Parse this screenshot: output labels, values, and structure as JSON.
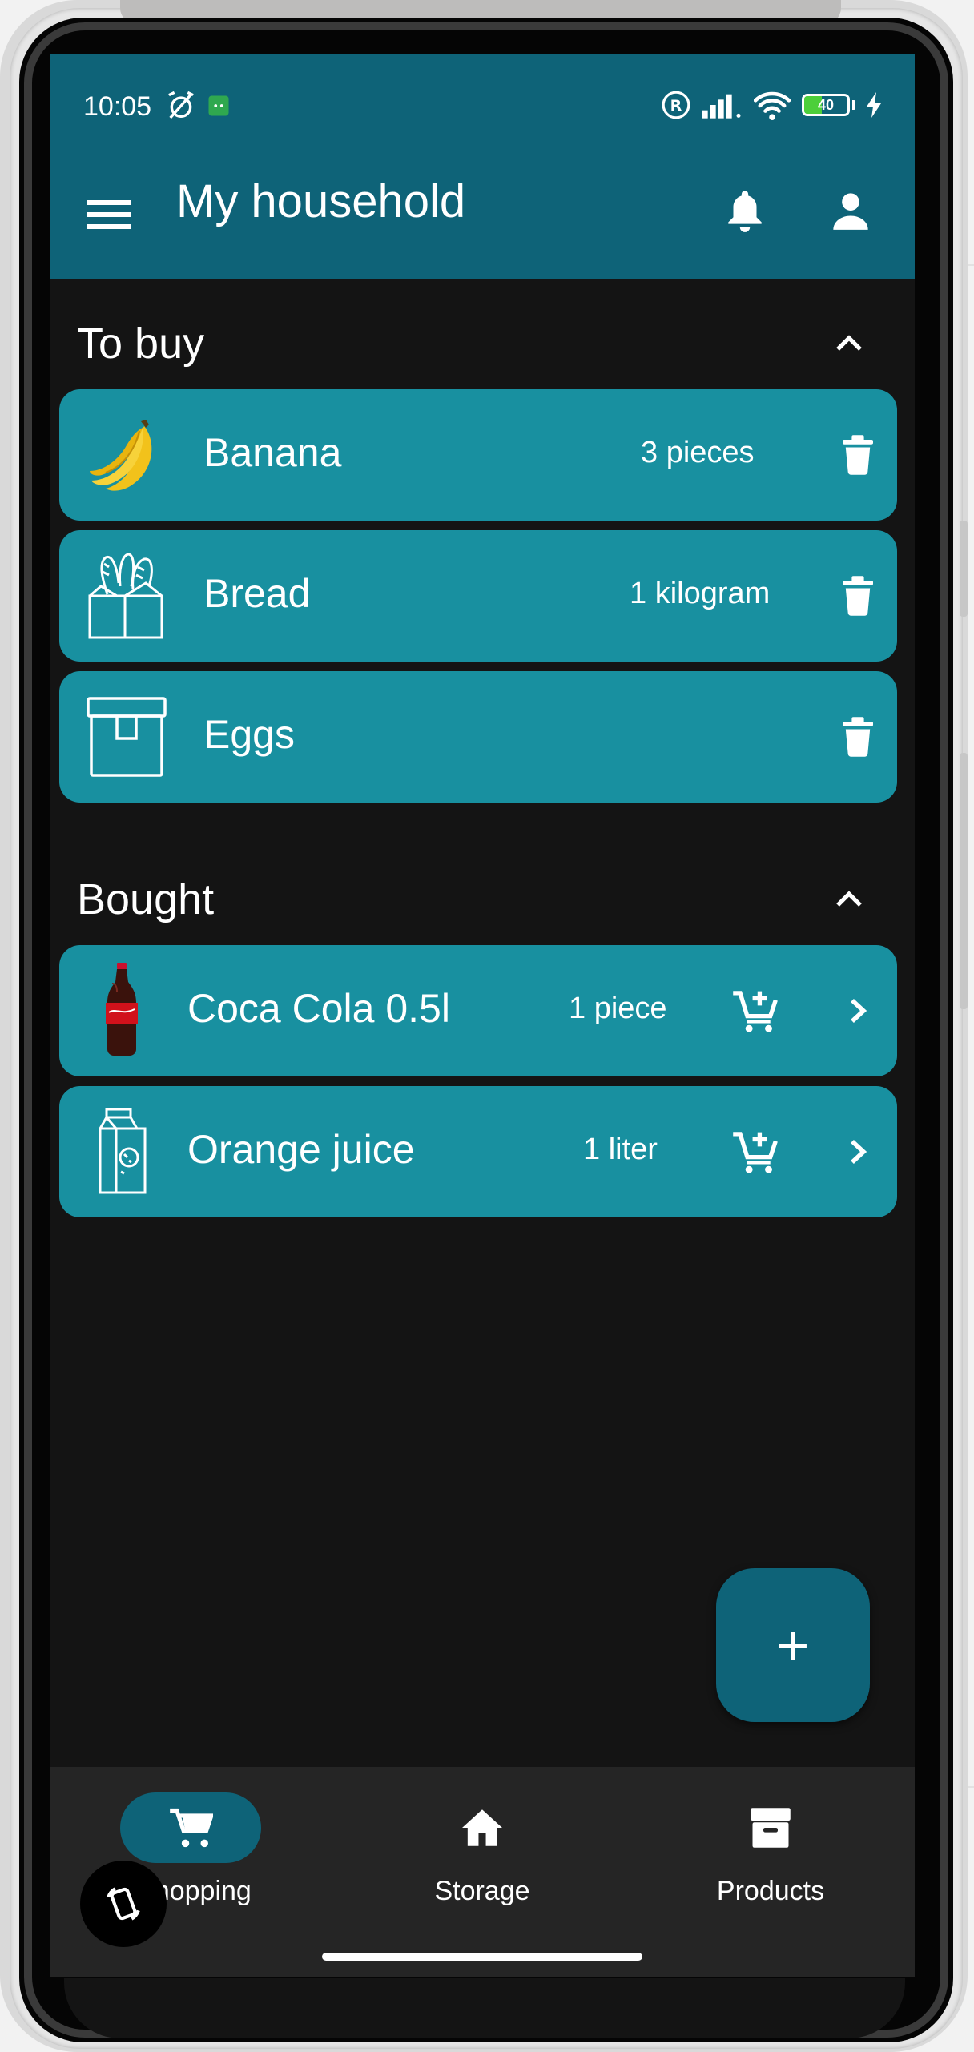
{
  "status_bar": {
    "time": "10:05",
    "battery": "40"
  },
  "app_bar": {
    "title": "My household"
  },
  "to_buy": {
    "title": "To buy",
    "items": [
      {
        "name": "Banana",
        "quantity": "3 pieces",
        "image": "banana-icon"
      },
      {
        "name": "Bread",
        "quantity": "1 kilogram",
        "image": "bread-bag-icon"
      },
      {
        "name": "Eggs",
        "quantity": "",
        "image": "storage-box-icon"
      }
    ]
  },
  "bought": {
    "title": "Bought",
    "items": [
      {
        "name": "Coca Cola 0.5l",
        "quantity": "1 piece",
        "image": "cola-bottle-icon"
      },
      {
        "name": "Orange juice",
        "quantity": "1 liter",
        "image": "juice-carton-icon"
      }
    ]
  },
  "fab": {
    "label": "+"
  },
  "bottom_nav": {
    "items": [
      {
        "label": "Shopping",
        "icon": "cart-icon",
        "selected": true
      },
      {
        "label": "Storage",
        "icon": "home-icon",
        "selected": false
      },
      {
        "label": "Products",
        "icon": "archive-icon",
        "selected": false
      }
    ]
  },
  "colors": {
    "primary": "#0e6378",
    "card": "#1890a0",
    "background": "#141414",
    "nav": "#252525"
  }
}
